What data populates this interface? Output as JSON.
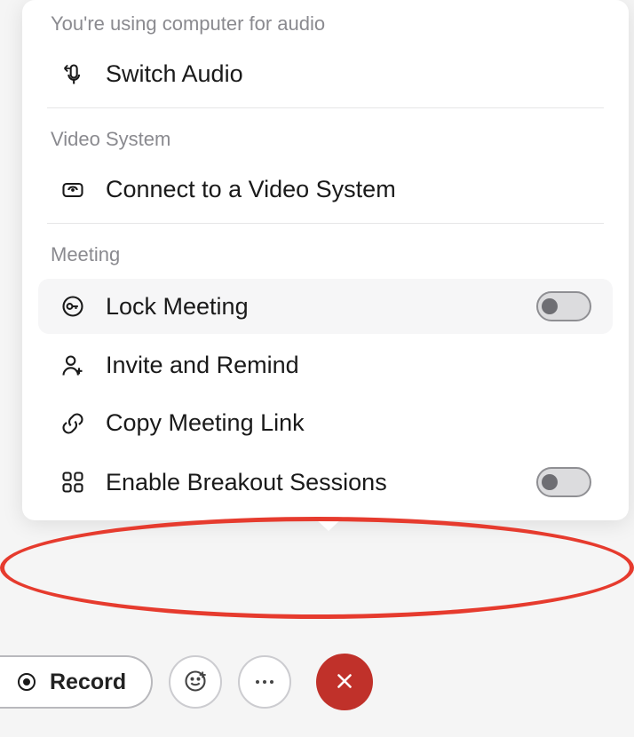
{
  "audio": {
    "section_label": "You're using computer for audio",
    "switch_audio_label": "Switch Audio"
  },
  "video_system": {
    "section_label": "Video System",
    "connect_label": "Connect to a Video System"
  },
  "meeting": {
    "section_label": "Meeting",
    "lock_label": "Lock Meeting",
    "lock_enabled": false,
    "invite_label": "Invite and Remind",
    "copy_link_label": "Copy Meeting Link",
    "breakout_label": "Enable Breakout Sessions",
    "breakout_enabled": false
  },
  "toolbar": {
    "record_label": "Record"
  },
  "colors": {
    "annotation": "#e63b2e",
    "close_button": "#c0312a"
  }
}
